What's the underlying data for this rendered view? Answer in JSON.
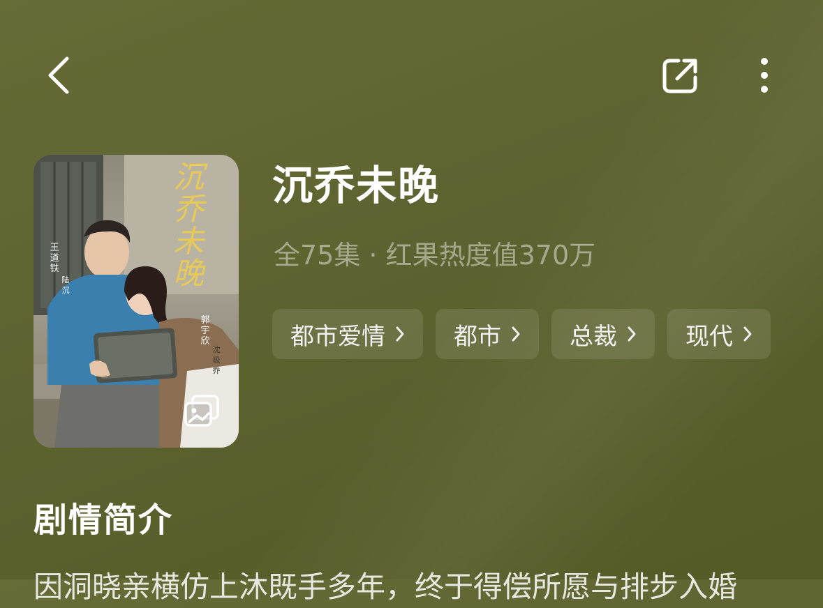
{
  "header": {
    "back_icon": "chevron-left-icon",
    "share_icon": "share-icon",
    "more_icon": "more-vertical-icon"
  },
  "poster": {
    "title_art": "沉乔未晚",
    "actor1": "王道铁",
    "role1": "陆沉",
    "actor2": "郭宇欣",
    "role2": "沈极乔",
    "gallery_icon": "gallery-icon"
  },
  "drama": {
    "title": "沉乔未晚",
    "meta": "全75集 · 红果热度值370万",
    "tags": [
      {
        "label": "都市爱情"
      },
      {
        "label": "都市"
      },
      {
        "label": "总裁"
      },
      {
        "label": "现代"
      }
    ]
  },
  "synopsis": {
    "heading": "剧情简介",
    "text": "因洞晓亲横仿上沐既手多年，终于得偿所愿与排步入婚"
  },
  "colors": {
    "background": "#5d6330",
    "accent_text": "#ffffff",
    "tag_bg": "rgba(255,255,255,0.10)"
  }
}
